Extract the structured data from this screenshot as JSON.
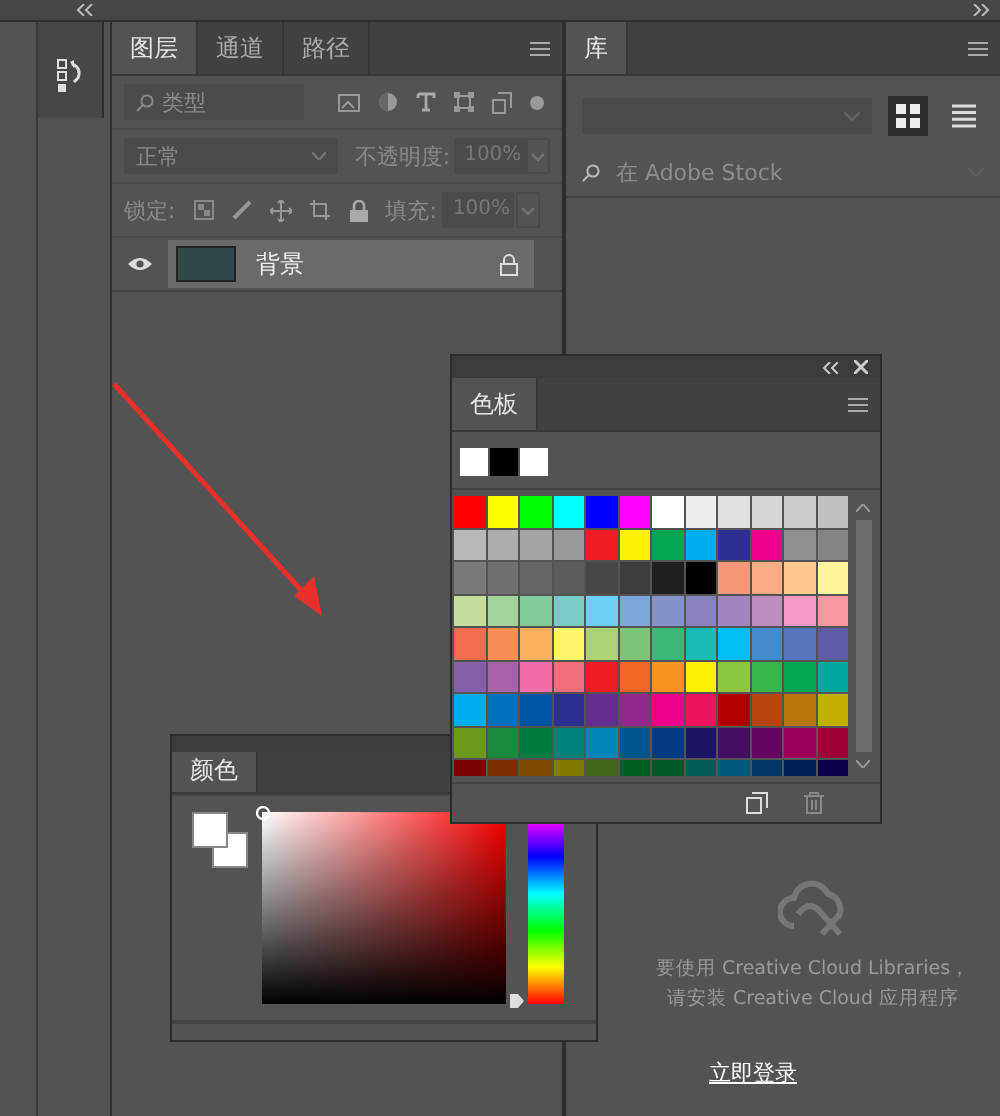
{
  "layers_panel": {
    "tabs": [
      {
        "label": "图层",
        "selected": true
      },
      {
        "label": "通道",
        "selected": false
      },
      {
        "label": "路径",
        "selected": false
      }
    ],
    "filter": {
      "value": "类型"
    },
    "blend_mode": "正常",
    "opacity": {
      "label": "不透明度:",
      "value": "100%"
    },
    "lock": {
      "label": "锁定:"
    },
    "fill": {
      "label": "填充:",
      "value": "100%"
    },
    "layers": [
      {
        "name": "背景",
        "visible": true,
        "selected": true,
        "locked": true
      }
    ]
  },
  "library_panel": {
    "tabs": [
      {
        "label": "库",
        "selected": true
      }
    ],
    "view_buttons": [
      {
        "kind": "grid",
        "selected": true
      },
      {
        "kind": "list",
        "selected": false
      }
    ],
    "search": {
      "placeholder": "在 Adobe Stock"
    },
    "message": [
      "要使用 Creative Cloud Libraries，",
      "请安装 Creative Cloud 应用程序"
    ],
    "link": "立即登录"
  },
  "swatches_panel": {
    "tabs": [
      {
        "label": "色板",
        "selected": true
      }
    ],
    "recent": [
      {
        "color": "#ffffff"
      },
      {
        "color": "#000000"
      },
      {
        "color": "#ffffff"
      }
    ],
    "swatches": [
      {
        "color": "#ff0000"
      },
      {
        "color": "#ffff00"
      },
      {
        "color": "#00ff00"
      },
      {
        "color": "#00ffff"
      },
      {
        "color": "#0000ff"
      },
      {
        "color": "#ff00ff"
      },
      {
        "color": "#ffffff"
      },
      {
        "color": "#ebebeb"
      },
      {
        "color": "#e0e0e0"
      },
      {
        "color": "#d6d6d6"
      },
      {
        "color": "#cccccc"
      },
      {
        "color": "#c2c2c2"
      },
      {
        "color": "#b8b8b8"
      },
      {
        "color": "#adadad"
      },
      {
        "color": "#a3a3a3"
      },
      {
        "color": "#999999"
      },
      {
        "color": "#ed1c24"
      },
      {
        "color": "#fff200"
      },
      {
        "color": "#00a651"
      },
      {
        "color": "#00aeef"
      },
      {
        "color": "#2e3192"
      },
      {
        "color": "#ec008c"
      },
      {
        "color": "#8f8f8f"
      },
      {
        "color": "#858585"
      },
      {
        "color": "#7a7a7a"
      },
      {
        "color": "#707070"
      },
      {
        "color": "#666666"
      },
      {
        "color": "#5c5c5c"
      },
      {
        "color": "#474747"
      },
      {
        "color": "#3d3d3d"
      },
      {
        "color": "#1f1f1f"
      },
      {
        "color": "#000000"
      },
      {
        "color": "#f7977a"
      },
      {
        "color": "#fbad82"
      },
      {
        "color": "#fdc68c"
      },
      {
        "color": "#fff799"
      },
      {
        "color": "#c4df9b"
      },
      {
        "color": "#a3d39c"
      },
      {
        "color": "#82ca9c"
      },
      {
        "color": "#7accc8"
      },
      {
        "color": "#6dcff6"
      },
      {
        "color": "#7da7d9"
      },
      {
        "color": "#8493ca"
      },
      {
        "color": "#8882be"
      },
      {
        "color": "#a187be"
      },
      {
        "color": "#bc8dbf"
      },
      {
        "color": "#f49ac2"
      },
      {
        "color": "#f6989d"
      },
      {
        "color": "#f26c4f"
      },
      {
        "color": "#f68e56"
      },
      {
        "color": "#fbaf5d"
      },
      {
        "color": "#fff568"
      },
      {
        "color": "#acd373"
      },
      {
        "color": "#7cc576"
      },
      {
        "color": "#3bb878"
      },
      {
        "color": "#1abbb4"
      },
      {
        "color": "#00bff3"
      },
      {
        "color": "#448ccb"
      },
      {
        "color": "#5574b9"
      },
      {
        "color": "#605ca8"
      },
      {
        "color": "#855fa8"
      },
      {
        "color": "#a763a8"
      },
      {
        "color": "#f06ea9"
      },
      {
        "color": "#f26d7d"
      },
      {
        "color": "#ed1c24"
      },
      {
        "color": "#f26522"
      },
      {
        "color": "#f7941d"
      },
      {
        "color": "#fff200"
      },
      {
        "color": "#8dc73f"
      },
      {
        "color": "#39b54a"
      },
      {
        "color": "#00a651"
      },
      {
        "color": "#00a99d"
      },
      {
        "color": "#00aeef"
      },
      {
        "color": "#0072bc"
      },
      {
        "color": "#0054a6"
      },
      {
        "color": "#2e3192"
      },
      {
        "color": "#662d91"
      },
      {
        "color": "#92278f"
      },
      {
        "color": "#ec008c"
      },
      {
        "color": "#ed145b"
      },
      {
        "color": "#b20000"
      },
      {
        "color": "#b5470d"
      },
      {
        "color": "#b8760a"
      },
      {
        "color": "#c2b000"
      },
      {
        "color": "#6b9a1f"
      },
      {
        "color": "#1a8a3a"
      },
      {
        "color": "#007a3d"
      },
      {
        "color": "#00807a"
      },
      {
        "color": "#0085b8"
      },
      {
        "color": "#00578f"
      },
      {
        "color": "#003a80"
      },
      {
        "color": "#1b1464"
      },
      {
        "color": "#440e62"
      },
      {
        "color": "#630460"
      },
      {
        "color": "#9e005d"
      },
      {
        "color": "#9e0039"
      },
      {
        "color": "#790000"
      },
      {
        "color": "#7b2e00"
      },
      {
        "color": "#7d4900"
      },
      {
        "color": "#827b00"
      },
      {
        "color": "#406618"
      },
      {
        "color": "#005e20"
      },
      {
        "color": "#005826"
      },
      {
        "color": "#005952"
      },
      {
        "color": "#005b7f"
      },
      {
        "color": "#003663"
      },
      {
        "color": "#002157"
      },
      {
        "color": "#0d004c"
      }
    ]
  },
  "color_panel": {
    "tabs": [
      {
        "label": "颜色",
        "selected": true
      }
    ],
    "foreground": {
      "color": "#ffffff"
    },
    "background": {
      "color": "#ffffff"
    },
    "hue_slider": {
      "level": 0
    }
  }
}
